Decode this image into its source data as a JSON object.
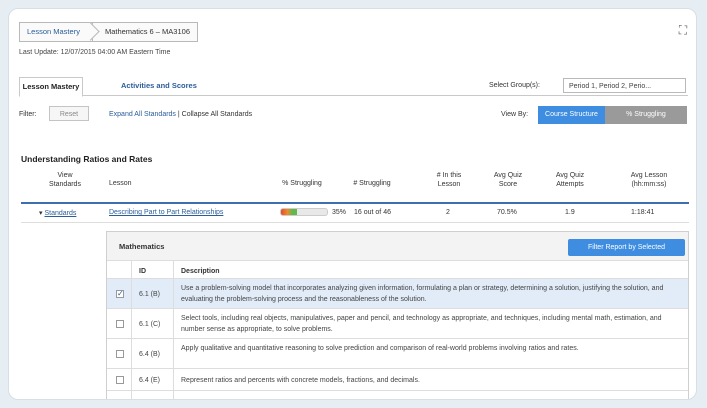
{
  "breadcrumb": {
    "first": "Lesson Mastery",
    "second": "Mathematics 6 – MA3106"
  },
  "last_update": "Last Update: 12/07/2015 04:00 AM Eastern Time",
  "tabs": [
    {
      "label": "Lesson Mastery",
      "active": true
    },
    {
      "label": "Activities and Scores",
      "active": false
    }
  ],
  "group": {
    "label": "Select Group(s):",
    "value": "Period 1, Period 2, Perio..."
  },
  "filter": {
    "label": "Filter:",
    "reset": "Reset",
    "expand": "Expand All Standards",
    "separator": " | ",
    "collapse": "Collapse All Standards"
  },
  "view_by": {
    "label": "View By:",
    "options": [
      "Course Structure",
      "% Struggling"
    ],
    "selected": "Course Structure"
  },
  "section_title": "Understanding Ratios and Rates",
  "columns": {
    "view_standards": "View Standards",
    "lesson": "Lesson",
    "pct_struggling": "% Struggling",
    "num_struggling": "# Struggling",
    "num_in_lesson": "# In this Lesson",
    "avg_quiz_score": "Avg Quiz Score",
    "avg_quiz_attempts": "Avg Quiz Attempts",
    "avg_lesson": "Avg Lesson (hh:mm:ss)"
  },
  "row": {
    "standards": "Standards",
    "lesson": "Describing Part to Part Relationships",
    "pct_struggling": "35%",
    "pct_value": 0.35,
    "num_struggling": "16 out of 46",
    "num_in_lesson": "2",
    "avg_quiz_score": "70.5%",
    "avg_quiz_attempts": "1.9",
    "avg_lesson": "1:18:41"
  },
  "standards_panel": {
    "title": "Mathematics",
    "filter_button": "Filter Report by Selected",
    "col_id": "ID",
    "col_description": "Description",
    "items": [
      {
        "id": "6.1 (B)",
        "checked": true,
        "description": "Use a problem-solving model that incorporates analyzing given information, formulating a plan or strategy, determining a solution, justifying the solution, and evaluating the problem-solving process and the reasonableness of the solution."
      },
      {
        "id": "6.1 (C)",
        "checked": false,
        "description": "Select tools, including real objects, manipulatives, paper and pencil, and technology as appropriate, and techniques, including mental math, estimation, and number sense as appropriate, to solve problems."
      },
      {
        "id": "6.4 (B)",
        "checked": false,
        "description": "Apply qualitative and quantitative reasoning to solve prediction and comparison of real-world problems involving ratios and rates."
      },
      {
        "id": "6.4 (E)",
        "checked": false,
        "description": "Represent ratios and percents with concrete models, fractions, and decimals."
      }
    ]
  },
  "colors": {
    "accent": "#3e8de0",
    "link": "#2a5d9a",
    "header_rule": "#3d6fb0",
    "selected_row": "#e2ecf8"
  }
}
